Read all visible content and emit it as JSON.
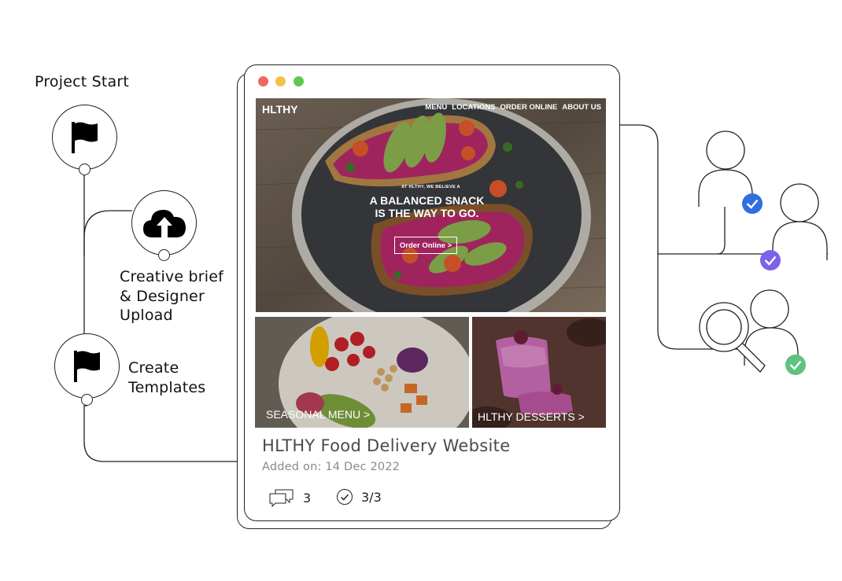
{
  "steps": [
    {
      "label": "Project Start",
      "icon": "flag-icon"
    },
    {
      "label": "Creative brief\n& Designer\nUpload",
      "icon": "cloud-upload-icon"
    },
    {
      "label": "Create\nTemplates",
      "icon": "flag-icon"
    }
  ],
  "window": {
    "buttons": [
      "close",
      "minimize",
      "maximize"
    ],
    "colors": {
      "close": "#ec6a5e",
      "minimize": "#f4bf4f",
      "maximize": "#61c554"
    }
  },
  "site": {
    "logo": "HLTHY",
    "nav": [
      "MENU",
      "LOCATIONS",
      "ORDER ONLINE",
      "ABOUT US"
    ],
    "kicker": "AT HLTHY, WE BELIEVE A",
    "headline": "A BALANCED SNACK\nIS THE WAY TO GO.",
    "cta": "Order Online >",
    "tiles": [
      {
        "label": "SEASONAL MENU >"
      },
      {
        "label": "HLTHY DESSERTS >"
      }
    ]
  },
  "card": {
    "title": "HLTHY Food Delivery Website",
    "added": "Added on: 14 Dec 2022",
    "comments": "3",
    "approvals": "3/3"
  },
  "reviewers": [
    {
      "icon": "user-icon",
      "status": "approved",
      "color": "#2f6de1"
    },
    {
      "icon": "user-icon",
      "status": "approved",
      "color": "#7d62e8"
    },
    {
      "icon": "user-search-icon",
      "status": "approved",
      "color": "#5fc27e"
    }
  ]
}
